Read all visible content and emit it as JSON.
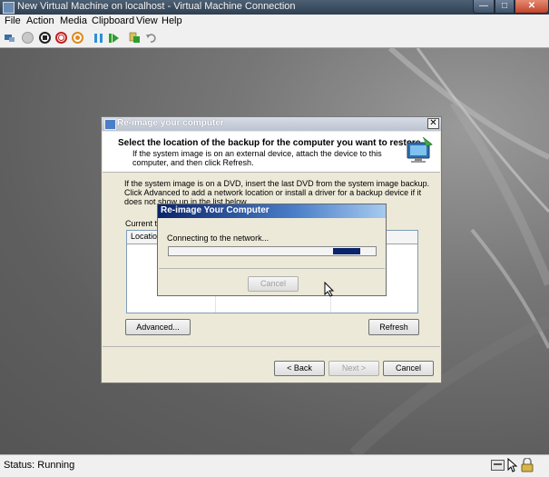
{
  "window": {
    "title": "New Virtual Machine on localhost - Virtual Machine Connection",
    "controls": {
      "minimize": "—",
      "maximize": "□",
      "close": "✕"
    }
  },
  "menu": [
    "File",
    "Action",
    "Media",
    "Clipboard",
    "View",
    "Help"
  ],
  "toolbar_icons": [
    "ctrl-alt-del-icon",
    "start-icon",
    "turn-off-icon",
    "shut-down-icon",
    "save-icon",
    "pause-icon",
    "reset-icon",
    "snapshot-icon",
    "revert-icon"
  ],
  "reimage_window": {
    "title": "Re-image your computer",
    "close": "✕",
    "heading": "Select the location of the backup for the computer you want to restore",
    "subtext": "If the system image is on an external device, attach the device to this computer, and then click Refresh.",
    "body": "If the system image is on a DVD, insert the last DVD from the system image backup. Click Advanced to add a network location or install a driver for a backup device if it does not show up in the list below.",
    "current_label": "Current ti",
    "table": {
      "columns": [
        "Location"
      ]
    },
    "advanced_button": "Advanced...",
    "refresh_button": "Refresh",
    "back_button": "< Back",
    "next_button": "Next >",
    "cancel_button": "Cancel"
  },
  "progress_dialog": {
    "title": "Re-image Your Computer",
    "message": "Connecting to the network...",
    "cancel_button": "Cancel",
    "progress_indicator": "marquee"
  },
  "status": {
    "text": "Status: Running"
  },
  "colors": {
    "titlebar": "#3b4b5e",
    "vm_background": "#6b6b6b",
    "progress_title": "#0a246a",
    "progress_block": "#0a246a",
    "close_button": "#c2432a"
  }
}
